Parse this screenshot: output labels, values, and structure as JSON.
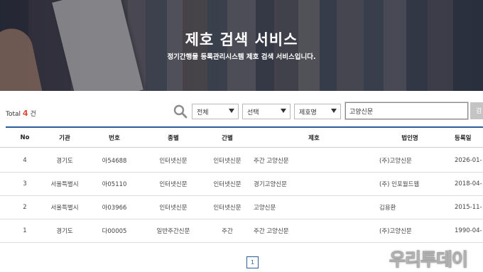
{
  "hero": {
    "title": "제호 검색 서비스",
    "subtitle": "정기간행물 등록관리시스템 제호 검색 서비스입니다."
  },
  "summary": {
    "total_label": "Total",
    "total_count": "4",
    "total_unit": "건"
  },
  "search": {
    "icon": "search-icon",
    "filter_1": "전체",
    "filter_2": "선택",
    "filter_3": "제호명",
    "query": "고양신문",
    "button_label": "검"
  },
  "table": {
    "headers": {
      "no": "No",
      "org": "기관",
      "num": "번호",
      "kind": "종별",
      "period": "간별",
      "title": "제호",
      "corp": "법인명",
      "date": "등록일"
    },
    "rows": [
      {
        "no": "4",
        "org": "경기도",
        "num": "아54688",
        "kind": "인터넷신문",
        "period": "인터넷신문",
        "title": "주간 고양신문",
        "corp": "(주)고양신문",
        "date": "2026-01-"
      },
      {
        "no": "3",
        "org": "서울특별시",
        "num": "아05110",
        "kind": "인터넷신문",
        "period": "인터넷신문",
        "title": "경기고양신문",
        "corp": "(주) 인포월드웹",
        "date": "2018-04-"
      },
      {
        "no": "2",
        "org": "서울특별시",
        "num": "아03966",
        "kind": "인터넷신문",
        "period": "인터넷신문",
        "title": "고양신문",
        "corp": "김용환",
        "date": "2015-11-"
      },
      {
        "no": "1",
        "org": "경기도",
        "num": "다00005",
        "kind": "일반주간신문",
        "period": "주간",
        "title": "주간 고양신문",
        "corp": "(주)고양신문",
        "date": "1990-04-"
      }
    ]
  },
  "pagination": {
    "current_page": "1"
  },
  "watermark": {
    "text": "우리투데이"
  },
  "colors": {
    "accent": "#2b5d9a",
    "count": "#e34a2f"
  }
}
